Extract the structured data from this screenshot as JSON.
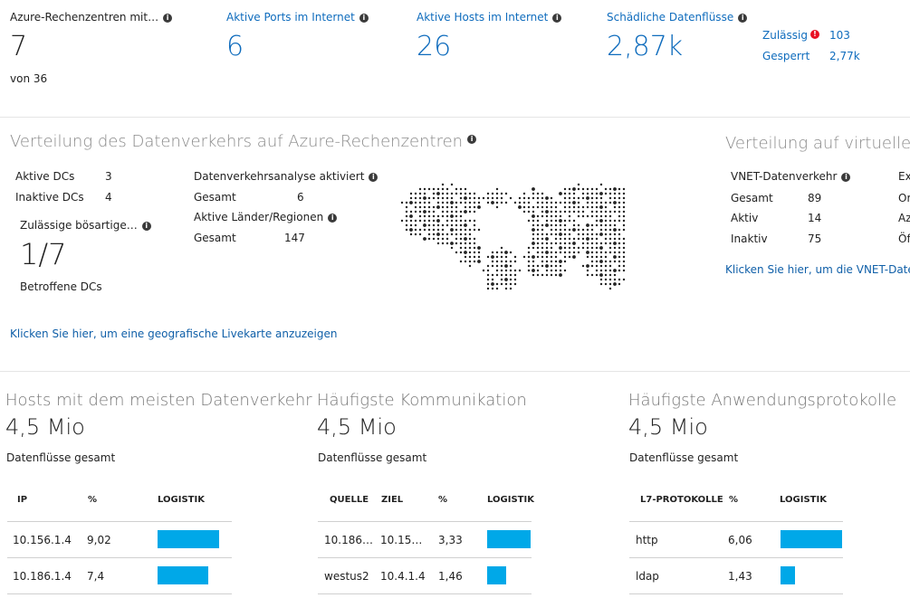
{
  "kpis": {
    "dc": {
      "label": "Azure-Rechenzentren mit…",
      "value": "7",
      "sub": "von 36"
    },
    "ports": {
      "label": "Aktive Ports im Internet",
      "value": "6"
    },
    "hosts": {
      "label": "Aktive Hosts im Internet",
      "value": "26"
    },
    "flows": {
      "label": "Schädliche Datenflüsse",
      "value": "2,87k"
    },
    "allowed": {
      "label": "Zulässig",
      "value": "103"
    },
    "blocked": {
      "label": "Gesperrt",
      "value": "2,77k"
    }
  },
  "traffic": {
    "title": "Verteilung des Datenverkehrs auf Azure-Rechenzentren",
    "active_dcs_label": "Aktive DCs",
    "active_dcs_value": "3",
    "inactive_dcs_label": "Inaktive DCs",
    "inactive_dcs_value": "4",
    "malicious_label": "Zulässige bösartige…",
    "ratio": "1/7",
    "affected_label": "Betroffene DCs",
    "analysis_label": "Datenverkehrsanalyse aktiviert",
    "analysis_total_label": "Gesamt",
    "analysis_total_value": "6",
    "countries_label": "Aktive Länder/Regionen",
    "countries_total_label": "Gesamt",
    "countries_total_value": "147",
    "geo_link": "Klicken Sie hier, um eine geografische Livekarte anzuzeigen"
  },
  "vnet": {
    "title": "Verteilung auf virtuelle",
    "traffic_label": "VNET-Datenverkehr",
    "total_label": "Gesamt",
    "total_value": "89",
    "active_label": "Aktiv",
    "active_value": "14",
    "inactive_label": "Inaktiv",
    "inactive_value": "75",
    "col2": [
      "Ex",
      "Or",
      "Az",
      "Öf"
    ],
    "link": "Klicken Sie hier, um die VNET-Date"
  },
  "tiles": [
    {
      "title": "Hosts mit dem meisten Datenverkehr",
      "total": "4,5 Mio",
      "total_label": "Datenflüsse gesamt",
      "columns": [
        "IP",
        "%",
        "LOGISTIK"
      ],
      "rows": [
        {
          "c1": "10.156.1.4",
          "pct": "9,02",
          "share": 9.02
        },
        {
          "c1": "10.186.1.4",
          "pct": "7,4",
          "share": 7.4
        }
      ]
    },
    {
      "title": "Häufigste Kommunikation",
      "total": "4,5 Mio",
      "total_label": "Datenflüsse gesamt",
      "columns": [
        "QUELLE",
        "ZIEL",
        "%",
        "LOGISTIK"
      ],
      "rows": [
        {
          "c1": "10.186…",
          "c2": "10.15…",
          "pct": "3,33",
          "share": 3.33
        },
        {
          "c1": "westus2",
          "c2": "10.4.1.4",
          "pct": "1,46",
          "share": 1.46
        }
      ]
    },
    {
      "title": "Häufigste Anwendungsprotokolle",
      "total": "4,5 Mio",
      "total_label": "Datenflüsse gesamt",
      "columns": [
        "L7-PROTOKOLLE",
        "%",
        "LOGISTIK"
      ],
      "rows": [
        {
          "c1": "http",
          "pct": "6,06",
          "share": 6.06
        },
        {
          "c1": "ldap",
          "pct": "1,43",
          "share": 1.43
        }
      ]
    }
  ]
}
